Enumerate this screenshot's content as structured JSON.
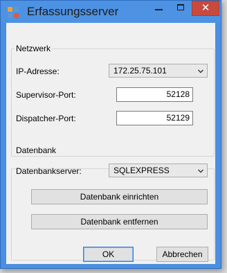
{
  "window": {
    "title": "Erfassungsserver",
    "close_glyph": "✕"
  },
  "network": {
    "legend": "Netzwerk",
    "ip_label": "IP-Adresse:",
    "ip_value": "172.25.75.101",
    "supervisor_label": "Supervisor-Port:",
    "supervisor_value": "52128",
    "dispatcher_label": "Dispatcher-Port:",
    "dispatcher_value": "52129"
  },
  "database": {
    "legend": "Datenbank",
    "server_label": "Datenbankserver:",
    "server_value": "SQLEXPRESS",
    "setup_button": "Datenbank einrichten",
    "remove_button": "Datenbank entfernen"
  },
  "footer": {
    "ok_button": "OK",
    "cancel_button": "Abbrechen"
  },
  "colors": {
    "titlebar": "#4d92e3",
    "close_button": "#c74a3f",
    "client_background": "#f0f0f0"
  }
}
